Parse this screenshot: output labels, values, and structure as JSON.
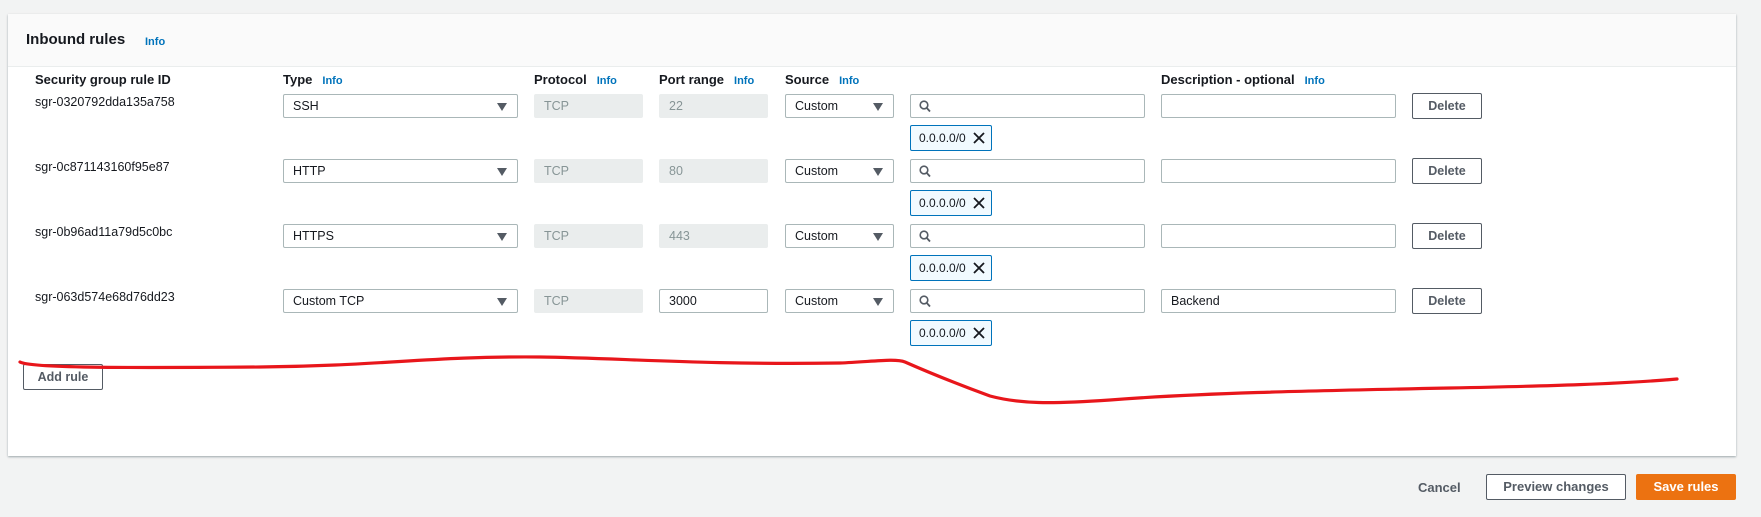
{
  "panel": {
    "title": "Inbound rules",
    "info": "Info"
  },
  "columns": {
    "rule_id": "Security group rule ID",
    "type": "Type",
    "protocol": "Protocol",
    "port_range": "Port range",
    "source": "Source",
    "description": "Description - optional",
    "info": "Info"
  },
  "rules": [
    {
      "id": "sgr-0320792dda135a758",
      "type": "SSH",
      "protocol": "TCP",
      "port": "22",
      "source": "Custom",
      "search": "",
      "cidr": "0.0.0.0/0",
      "description": "",
      "delete": "Delete"
    },
    {
      "id": "sgr-0c871143160f95e87",
      "type": "HTTP",
      "protocol": "TCP",
      "port": "80",
      "source": "Custom",
      "search": "",
      "cidr": "0.0.0.0/0",
      "description": "",
      "delete": "Delete"
    },
    {
      "id": "sgr-0b96ad11a79d5c0bc",
      "type": "HTTPS",
      "protocol": "TCP",
      "port": "443",
      "source": "Custom",
      "search": "",
      "cidr": "0.0.0.0/0",
      "description": "",
      "delete": "Delete"
    },
    {
      "id": "sgr-063d574e68d76dd23",
      "type": "Custom TCP",
      "protocol": "TCP",
      "port": "3000",
      "source": "Custom",
      "search": "",
      "cidr": "0.0.0.0/0",
      "description": "Backend",
      "delete": "Delete"
    }
  ],
  "add_rule": "Add rule",
  "footer": {
    "cancel": "Cancel",
    "preview": "Preview changes",
    "save": "Save rules"
  },
  "colors": {
    "accent": "#ec7211",
    "link": "#0073bb",
    "annotation": "#e8161b"
  }
}
